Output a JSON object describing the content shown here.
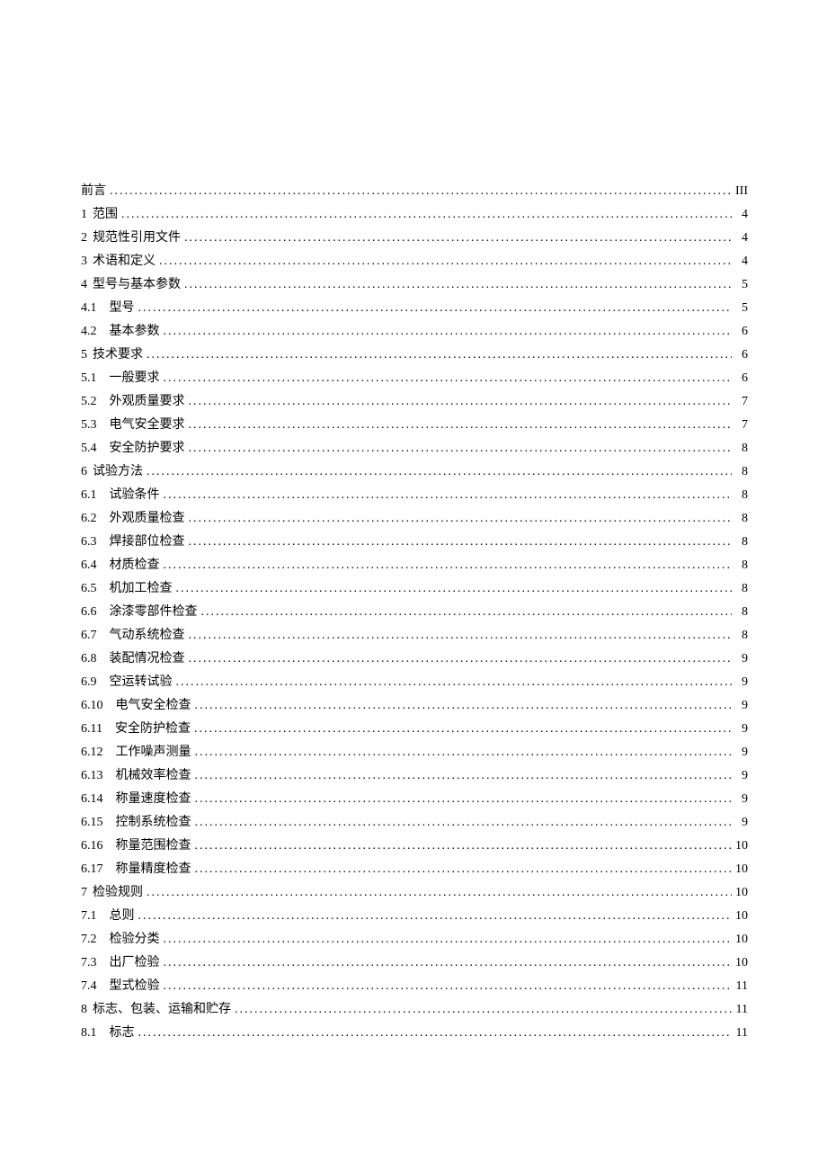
{
  "toc": [
    {
      "level": 1,
      "num": "",
      "title": "前言",
      "page": "III"
    },
    {
      "level": 1,
      "num": "1",
      "title": "范围",
      "page": "4"
    },
    {
      "level": 1,
      "num": "2",
      "title": "规范性引用文件",
      "page": "4"
    },
    {
      "level": 1,
      "num": "3",
      "title": "术语和定义",
      "page": "4"
    },
    {
      "level": 1,
      "num": "4",
      "title": "型号与基本参数",
      "page": "5"
    },
    {
      "level": 2,
      "num": "4.1",
      "title": "型号",
      "page": "5"
    },
    {
      "level": 2,
      "num": "4.2",
      "title": "基本参数",
      "page": "6"
    },
    {
      "level": 1,
      "num": "5",
      "title": "技术要求",
      "page": "6"
    },
    {
      "level": 2,
      "num": "5.1",
      "title": "一般要求",
      "page": "6"
    },
    {
      "level": 2,
      "num": "5.2",
      "title": "外观质量要求",
      "page": "7"
    },
    {
      "level": 2,
      "num": "5.3",
      "title": "电气安全要求",
      "page": "7"
    },
    {
      "level": 2,
      "num": "5.4",
      "title": "安全防护要求",
      "page": "8"
    },
    {
      "level": 1,
      "num": "6",
      "title": "试验方法",
      "page": "8"
    },
    {
      "level": 2,
      "num": "6.1",
      "title": "试验条件",
      "page": "8"
    },
    {
      "level": 2,
      "num": "6.2",
      "title": "外观质量检查",
      "page": "8"
    },
    {
      "level": 2,
      "num": "6.3",
      "title": "焊接部位检查",
      "page": "8"
    },
    {
      "level": 2,
      "num": "6.4",
      "title": "材质检查",
      "page": "8"
    },
    {
      "level": 2,
      "num": "6.5",
      "title": "机加工检查",
      "page": "8"
    },
    {
      "level": 2,
      "num": "6.6",
      "title": "涂漆零部件检查",
      "page": "8"
    },
    {
      "level": 2,
      "num": "6.7",
      "title": "气动系统检查",
      "page": "8"
    },
    {
      "level": 2,
      "num": "6.8",
      "title": "装配情况检查",
      "page": "9"
    },
    {
      "level": 2,
      "num": "6.9",
      "title": "空运转试验",
      "page": "9"
    },
    {
      "level": 2,
      "num": "6.10",
      "title": "电气安全检查",
      "page": "9"
    },
    {
      "level": 2,
      "num": "6.11",
      "title": "安全防护检查",
      "page": "9"
    },
    {
      "level": 2,
      "num": "6.12",
      "title": "工作噪声测量",
      "page": "9"
    },
    {
      "level": 2,
      "num": "6.13",
      "title": "机械效率检查",
      "page": "9"
    },
    {
      "level": 2,
      "num": "6.14",
      "title": "称量速度检查",
      "page": "9"
    },
    {
      "level": 2,
      "num": "6.15",
      "title": "控制系统检查",
      "page": "9"
    },
    {
      "level": 2,
      "num": "6.16",
      "title": "称量范围检查",
      "page": "10"
    },
    {
      "level": 2,
      "num": "6.17",
      "title": "称量精度检查",
      "page": "10"
    },
    {
      "level": 1,
      "num": "7",
      "title": "检验规则",
      "page": "10"
    },
    {
      "level": 2,
      "num": "7.1",
      "title": "总则",
      "page": "10"
    },
    {
      "level": 2,
      "num": "7.2",
      "title": "检验分类",
      "page": "10"
    },
    {
      "level": 2,
      "num": "7.3",
      "title": "出厂检验",
      "page": "10"
    },
    {
      "level": 2,
      "num": "7.4",
      "title": "型式检验",
      "page": "11"
    },
    {
      "level": 1,
      "num": "8",
      "title": "标志、包装、运输和贮存",
      "page": "11"
    },
    {
      "level": 2,
      "num": "8.1",
      "title": "标志",
      "page": "11"
    }
  ]
}
